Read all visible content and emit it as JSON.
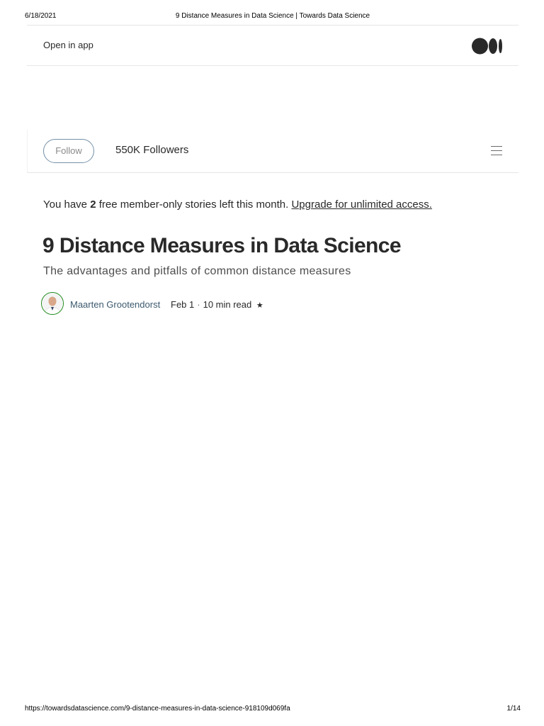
{
  "print_header": {
    "date": "6/18/2021",
    "title": "9 Distance Measures in Data Science | Towards Data Science"
  },
  "topbar": {
    "open_in_app": "Open in app",
    "logo_icon": "medium-logo-icon"
  },
  "publication_bar": {
    "follow_label": "Follow",
    "followers": "550K Followers",
    "menu_icon": "hamburger-menu-icon"
  },
  "member_notice": {
    "prefix": "You have ",
    "count": "2",
    "suffix": " free member-only stories left this month.",
    "upgrade_link": "Upgrade for unlimited access."
  },
  "article": {
    "title": "9 Distance Measures in Data Science",
    "subtitle": "The advantages and pitfalls of common distance measures",
    "author": "Maarten Grootendorst",
    "date": "Feb 1",
    "separator": "·",
    "read_time": "10 min read",
    "star": "★"
  },
  "print_footer": {
    "url": "https://towardsdatascience.com/9-distance-measures-in-data-science-918109d069fa",
    "page": "1/14"
  },
  "colors": {
    "text": "#292929",
    "follow_border": "#7590a8",
    "avatar_ring": "#1a8917",
    "divider": "#e6e6e6"
  }
}
